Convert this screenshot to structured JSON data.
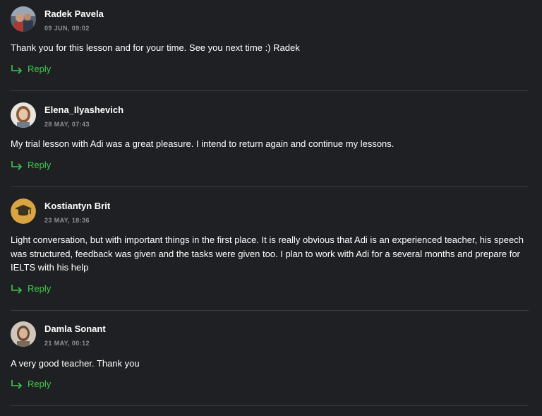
{
  "reviews": [
    {
      "author": "Radek Pavela",
      "date": "09 JUN, 09:02",
      "text": "Thank you for this lesson and for your time. See you next time :) Radek",
      "reply_label": "Reply",
      "avatar": "photo-avatar"
    },
    {
      "author": "Elena_Ilyashevich",
      "date": "28 MAY, 07:43",
      "text": "My trial lesson with Adi was a great pleasure. I intend to return again and continue my lessons.",
      "reply_label": "Reply",
      "avatar": "photo-avatar"
    },
    {
      "author": "Kostiantyn Brit",
      "date": "23 MAY, 18:36",
      "text": "Light conversation, but with important things in the first place. It is really obvious that Adi is an experienced teacher, his speech was structured, feedback was given and the tasks were given too. I plan to work with Adi for a several months and prepare for IELTS with his help",
      "reply_label": "Reply",
      "avatar": "graduation-cap-icon"
    },
    {
      "author": "Damla Sonant",
      "date": "21 MAY, 00:12",
      "text": "A very good teacher. Thank you",
      "reply_label": "Reply",
      "avatar": "photo-avatar"
    }
  ],
  "colors": {
    "background": "#1f2023",
    "accent": "#3fc84a",
    "muted": "#8f9196",
    "divider": "#3a3b3f",
    "avatar_badge": "#d9a441"
  }
}
